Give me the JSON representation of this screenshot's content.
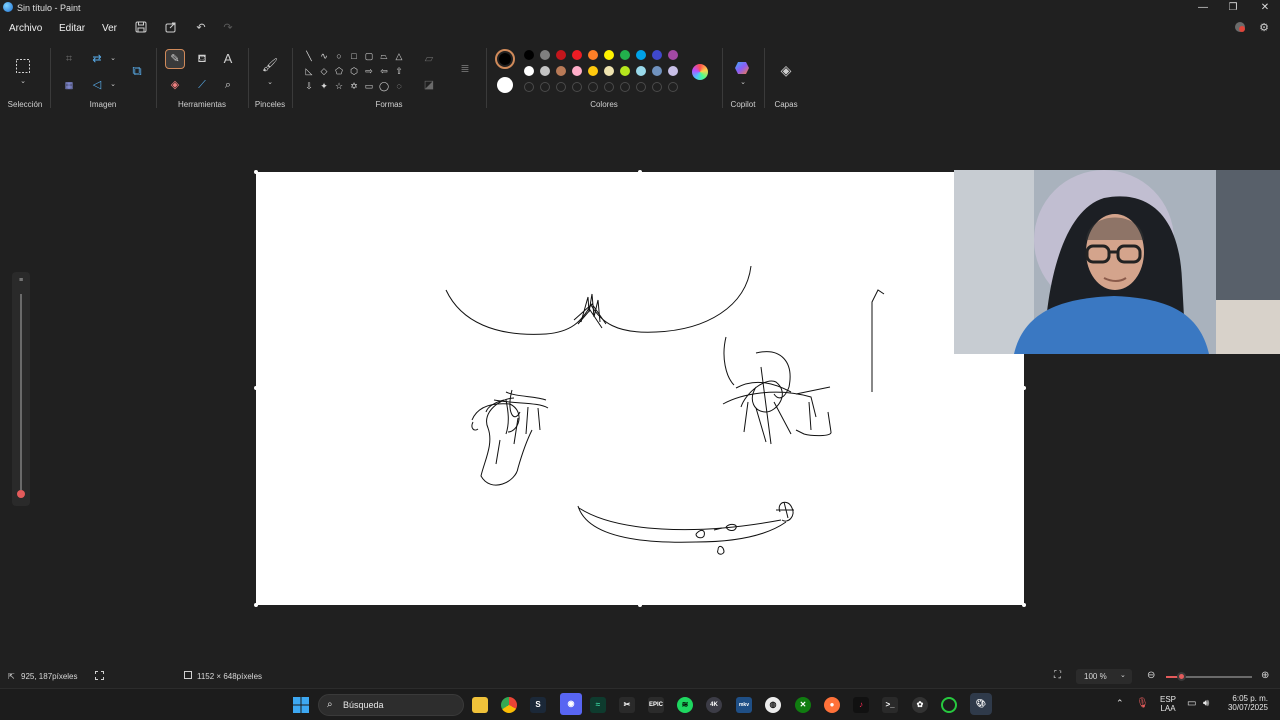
{
  "window": {
    "title": "Sin título - Paint",
    "minimize_icon": "minimize-icon",
    "maximize_icon": "restore-icon",
    "close_icon": "close-icon"
  },
  "menu": {
    "file": "Archivo",
    "edit": "Editar",
    "view": "Ver"
  },
  "ribbon": {
    "groups": {
      "selection": "Selección",
      "image": "Imagen",
      "tools": "Herramientas",
      "brushes": "Pinceles",
      "shapes": "Formas",
      "colors": "Colores",
      "copilot": "Copilot",
      "layers": "Capas"
    },
    "active_tool": "pencil",
    "primary_color": "#000000",
    "secondary_color": "#ffffff",
    "palette_row1": [
      "#000000",
      "#7f7f7f",
      "#c3161c",
      "#ed1c24",
      "#ff7f27",
      "#fff200",
      "#22b14c",
      "#00a2e8",
      "#3f48cc",
      "#a349a4"
    ],
    "palette_row2": [
      "#ffffff",
      "#c3c3c3",
      "#b97a57",
      "#ffaec9",
      "#ffc90e",
      "#efe4b0",
      "#b5e61d",
      "#99d9ea",
      "#7092be",
      "#c8bfe7"
    ]
  },
  "status": {
    "cursor_position": "925, 187píxeles",
    "canvas_size": "1152 × 648píxeles",
    "zoom": "100 %"
  },
  "taskbar": {
    "search_label": "Búsqueda",
    "language": "ESP",
    "layout": "LAA",
    "time": "6:05 p. m.",
    "date": "30/07/2025"
  }
}
